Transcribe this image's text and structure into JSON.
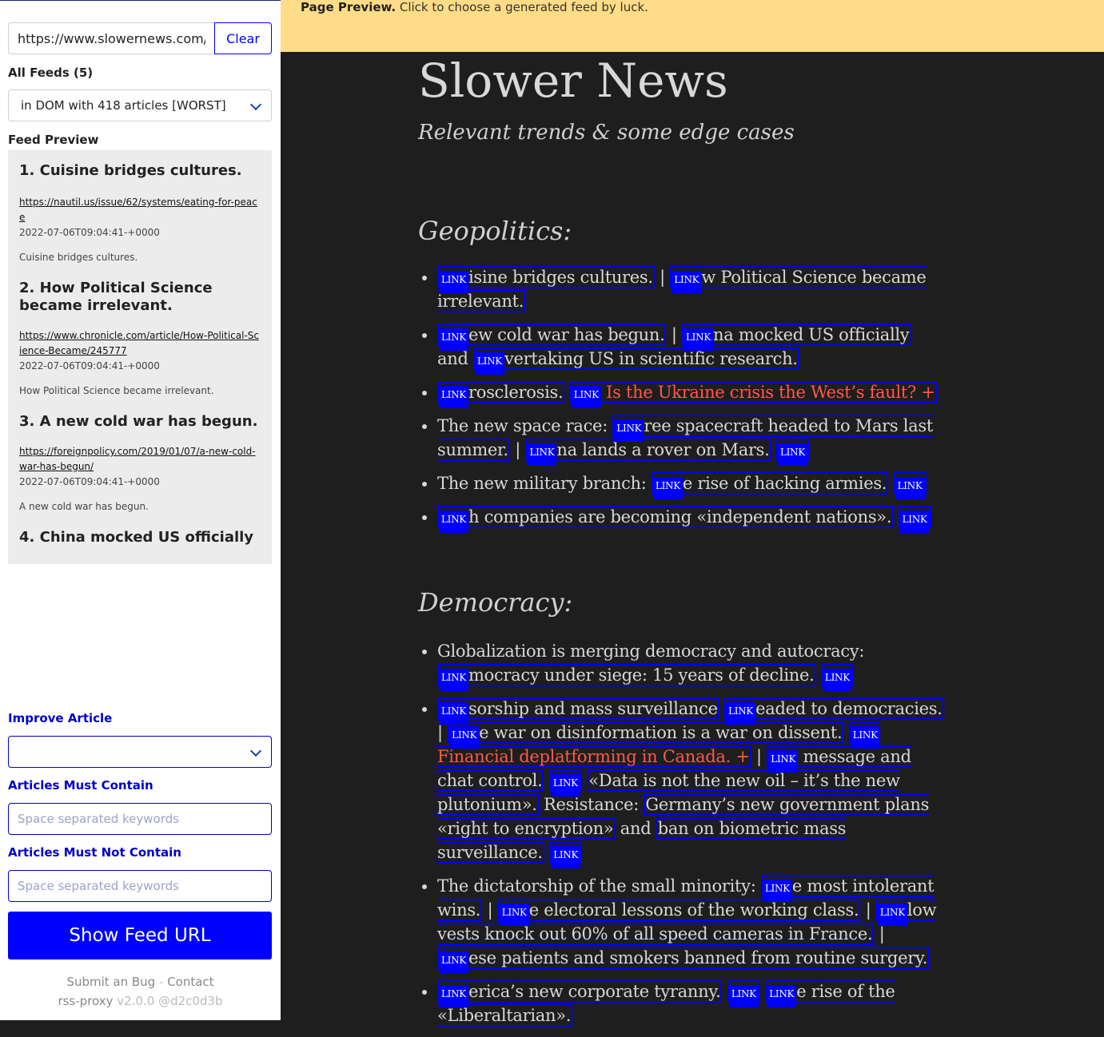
{
  "sidebar": {
    "url_value": "https://www.slowernews.com/",
    "clear_label": "Clear",
    "all_feeds_label": "All Feeds (5)",
    "feed_select_value": "in DOM with 418 articles [WORST]",
    "feed_preview_label": "Feed Preview",
    "preview_items": [
      {
        "title": "1. Cuisine bridges cultures.",
        "link": "https://nautil.us/issue/62/systems/eating-for-peace",
        "date": "2022-07-06T09:04:41-+0000",
        "desc": "Cuisine bridges cultures."
      },
      {
        "title": "2. How Political Science became irrelevant.",
        "link": "https://www.chronicle.com/article/How-Political-Science-Became/245777",
        "date": "2022-07-06T09:04:41-+0000",
        "desc": "How Political Science became irrelevant."
      },
      {
        "title": "3. A new cold war has begun.",
        "link": "https://foreignpolicy.com/2019/01/07/a-new-cold-war-has-begun/",
        "date": "2022-07-06T09:04:41-+0000",
        "desc": "A new cold war has begun."
      },
      {
        "title": "4. China mocked US officially"
      }
    ],
    "improve_label": "Improve Article",
    "improve_value": "",
    "must_contain_label": "Articles Must Contain",
    "must_contain_placeholder": "Space separated keywords",
    "must_not_contain_label": "Articles Must Not Contain",
    "must_not_contain_placeholder": "Space separated keywords",
    "show_feed_label": "Show Feed URL",
    "submit_bug": "Submit an Bug",
    "footer_sep": "-",
    "contact": "Contact",
    "app_name": "rss-proxy",
    "version": "v2.0.0 @d2c0d3b"
  },
  "banner": {
    "bold": "Page Preview.",
    "text": " Click to choose a generated feed by luck."
  },
  "page": {
    "title": "Slower News",
    "subtitle": "Relevant trends & some edge cases",
    "tag": "LINK",
    "bar": "|",
    "geo_heading": "Geopolitics:",
    "geo": {
      "i1a": "isine bridges cultures.",
      "i1b": "w Political Science became irrelevant.",
      "i2a": "ew cold war has begun.",
      "i2b": "na mocked US officially",
      "i2and": " and ",
      "i2c": "vertaking US in scientific research.",
      "i3a": "rosclerosis.",
      "i3b": "Is the Ukraine crisis the West’s fault? +",
      "i4pre": "The new space race: ",
      "i4a": "ree spacecraft headed to Mars last summer.",
      "i4b": "na lands a rover on Mars.",
      "i5pre": "The new military branch: ",
      "i5a": "e rise of hacking armies.",
      "i6a": "h companies are becoming «independent nations»."
    },
    "dem_heading": "Democracy:",
    "dem": {
      "d1pre": "Globalization is merging democracy and autocracy: ",
      "d1a": "mocracy under siege: 15 years of decline.",
      "d2a": "sorship and mass surveillance",
      "d2b": "eaded to democracies.",
      "d2c": "e war on disinformation is a war on dissent.",
      "d2d": "Financial deplatforming in Canada. +",
      "d2e": "message and chat control.",
      "d2f": "«Data is not the new oil – it’s the new plutonium».",
      "d2resist": " Resistance: ",
      "d2g": "Germany’s new government plans «right to encryption»",
      "d2and": " and ",
      "d2h": "ban on biometric mass surveillance.",
      "d3pre": "The dictatorship of the small minority: ",
      "d3a": "e most intolerant wins.",
      "d3b": "e electoral lessons of the working class.",
      "d3c": "low vests knock out 60% of all speed cameras in France.",
      "d3d": "ese patients and smokers banned from routine surgery.",
      "d4a": "erica’s new corporate tyranny.",
      "d4b": "e rise of the «Liberaltarian»."
    }
  }
}
